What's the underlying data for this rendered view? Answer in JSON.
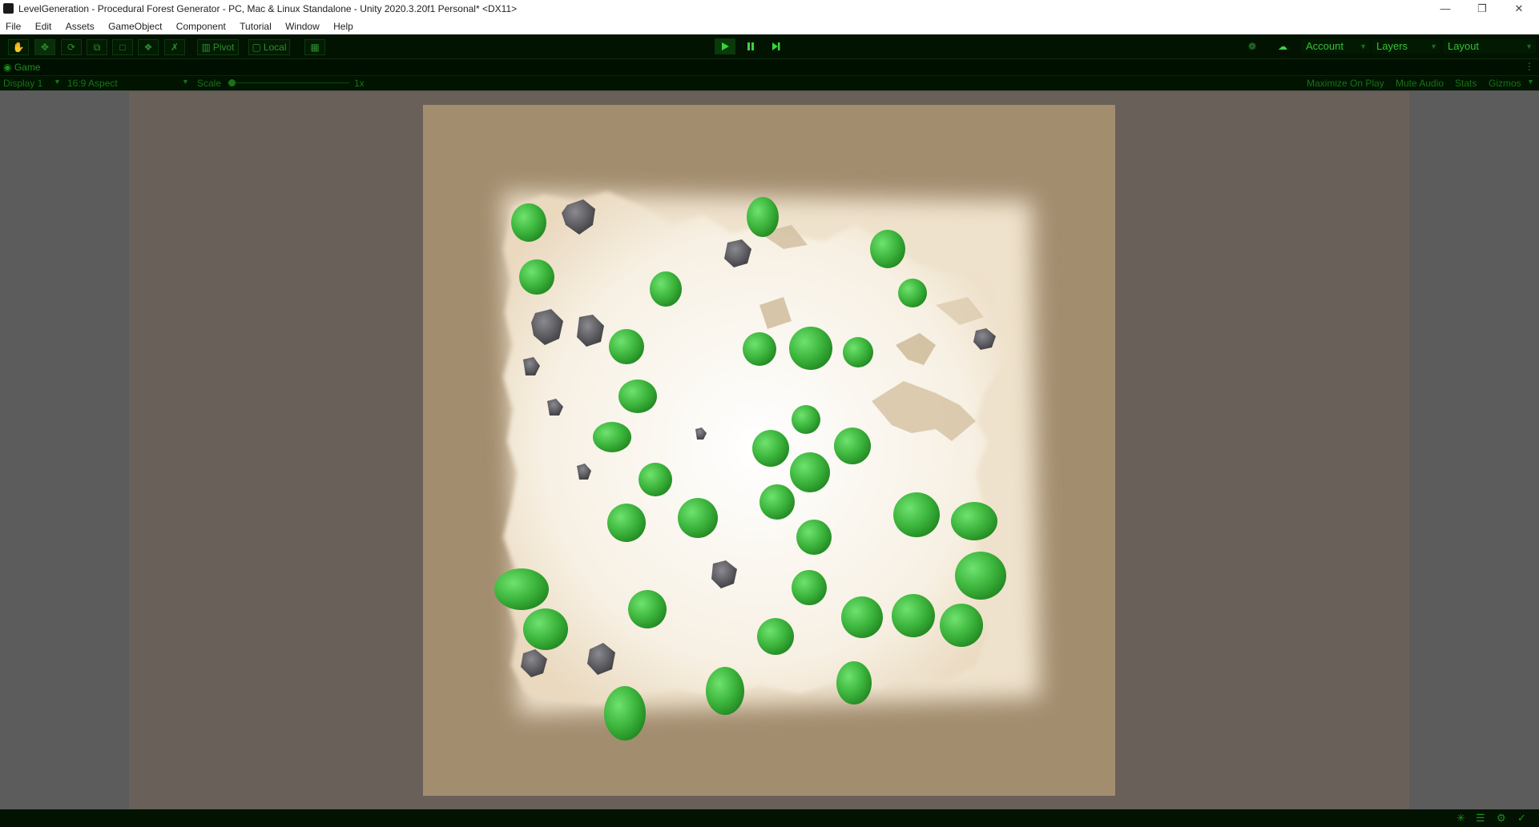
{
  "window": {
    "title": "LevelGeneration - Procedural Forest Generator - PC, Mac & Linux Standalone - Unity 2020.3.20f1 Personal* <DX11>",
    "controls": [
      "minimize",
      "restore",
      "close"
    ]
  },
  "menu": [
    "File",
    "Edit",
    "Assets",
    "GameObject",
    "Component",
    "Tutorial",
    "Window",
    "Help"
  ],
  "toolbar": {
    "pivot_label": "Pivot",
    "local_label": "Local",
    "account_label": "Account",
    "layers_label": "Layers",
    "layout_label": "Layout"
  },
  "game_view": {
    "tab_label": "Game",
    "display_label": "Display 1",
    "aspect_label": "16:9 Aspect",
    "scale_label": "Scale",
    "scale_value": "1x",
    "maximize_label": "Maximize On Play",
    "mute_label": "Mute Audio",
    "stats_label": "Stats",
    "gizmos_label": "Gizmos"
  },
  "colors": {
    "accent_green": "#2fd12f",
    "toolbar_bg": "#021302",
    "ground": "#a38d6f",
    "clearing": "#f6efe2",
    "tree": "#3fb83f",
    "rock": "#5b5b60"
  }
}
